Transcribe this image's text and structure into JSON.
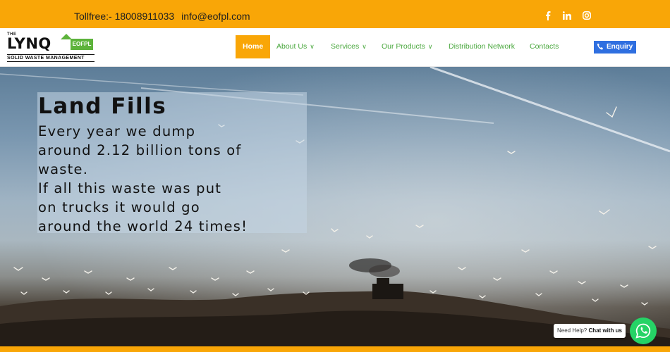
{
  "topbar": {
    "tollfree": "Tollfree:- 18008911033",
    "email": "info@eofpl.com",
    "social_icons": [
      "facebook-icon",
      "linkedin-icon",
      "instagram-icon"
    ],
    "background": "#f9a607"
  },
  "logo": {
    "the": "THE",
    "name": "LYNQ",
    "badge": "EOFPL",
    "tagline": "SOLID WASTE MANAGEMENT"
  },
  "nav": {
    "items": [
      {
        "label": "Home",
        "active": true,
        "dropdown": false
      },
      {
        "label": "About Us",
        "active": false,
        "dropdown": true
      },
      {
        "label": "Services",
        "active": false,
        "dropdown": true
      },
      {
        "label": "Our Products",
        "active": false,
        "dropdown": true
      },
      {
        "label": "Distribution Network",
        "active": false,
        "dropdown": false
      },
      {
        "label": "Contacts",
        "active": false,
        "dropdown": false
      }
    ],
    "enquiry_label": "Enquiry",
    "accent": "#4aa83e"
  },
  "hero": {
    "title": "Land Fills",
    "body_lines": [
      "Every year we dump",
      "around 2.12 billion tons of",
      "waste.",
      "If all this waste was put",
      "on trucks it would go",
      "around the world 24 times!"
    ]
  },
  "chat": {
    "prompt": "Need Help?",
    "action": "Chat with us",
    "icon": "whatsapp-icon",
    "color": "#25d366"
  }
}
